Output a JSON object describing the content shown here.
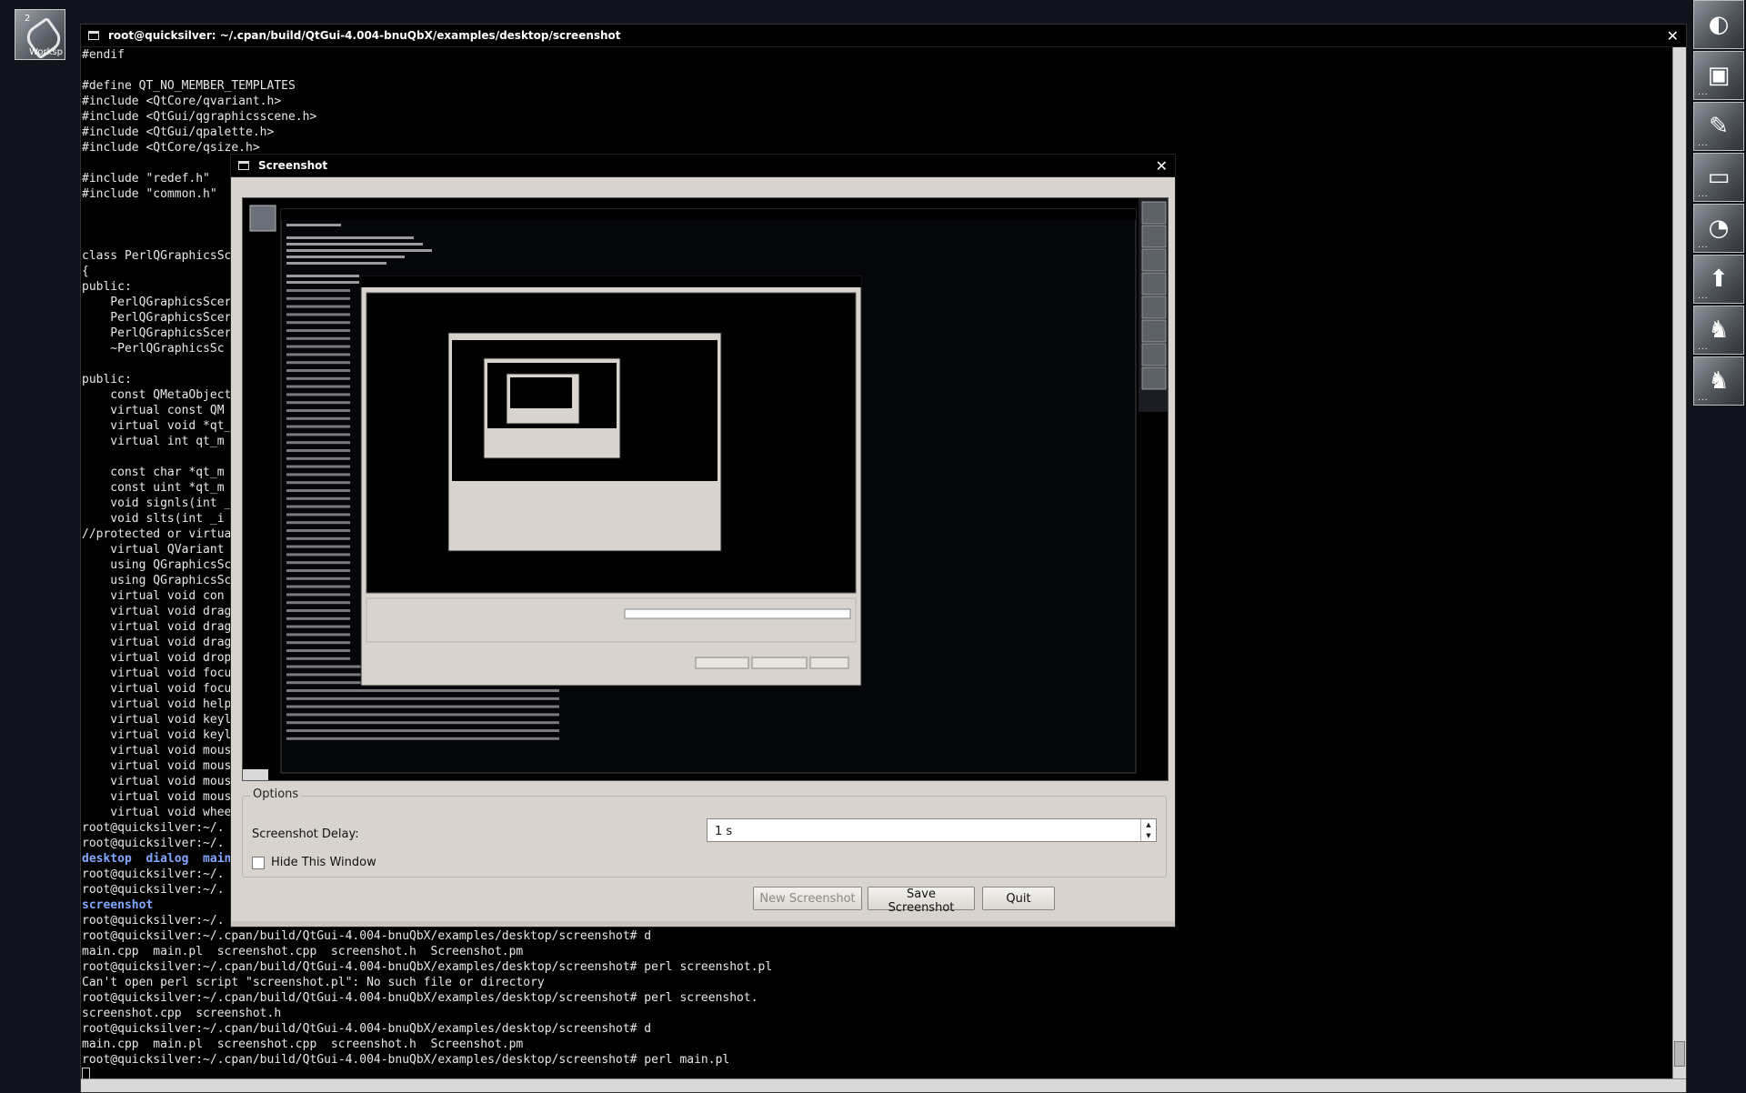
{
  "workspace": {
    "number": "2",
    "label": "Worksp"
  },
  "dock": {
    "tiles": [
      "◐",
      "▣",
      "✎",
      "▭",
      "◔",
      "⬆",
      "♞",
      "♞"
    ]
  },
  "terminal": {
    "title": "root@quicksilver: ~/.cpan/build/QtGui-4.004-bnuQbX/examples/desktop/screenshot",
    "close": "✕",
    "lines": [
      "#endif",
      "",
      "#define QT_NO_MEMBER_TEMPLATES",
      "#include <QtCore/qvariant.h>",
      "#include <QtGui/qgraphicsscene.h>",
      "#include <QtGui/qpalette.h>",
      "#include <QtCore/qsize.h>",
      "",
      "#include \"redef.h\"",
      "#include \"common.h\"",
      "",
      "",
      "",
      "class PerlQGraphicsSc",
      "{",
      "public:",
      "    PerlQGraphicsScer",
      "    PerlQGraphicsScer",
      "    PerlQGraphicsScer",
      "    ~PerlQGraphicsSc",
      "",
      "public:",
      "    const QMetaObject",
      "    virtual const QM",
      "    virtual void *qt_",
      "    virtual int qt_m",
      "",
      "    const char *qt_m",
      "    const uint *qt_m",
      "    void signls(int _",
      "    void slts(int _i",
      "//protected or virtua",
      "    virtual QVariant",
      "    using QGraphicsSc",
      "    using QGraphicsSc",
      "    virtual void con",
      "    virtual void drag",
      "    virtual void drag",
      "    virtual void drag",
      "    virtual void drop",
      "    virtual void focu",
      "    virtual void focu",
      "    virtual void help",
      "    virtual void keyl",
      "    virtual void keyl",
      "    virtual void mous",
      "    virtual void mous",
      "    virtual void mous",
      "    virtual void mous",
      "    virtual void whee",
      "root@quicksilver:~/.",
      "root@quicksilver:~/."
    ],
    "ls_line": "desktop  dialog  main",
    "lines_b": [
      "root@quicksilver:~/.",
      "root@quicksilver:~/."
    ],
    "screenshot_dir": "screenshot",
    "lines_c": [
      "root@quicksilver:~/.",
      "root@quicksilver:~/.cpan/build/QtGui-4.004-bnuQbX/examples/desktop/screenshot# d",
      "main.cpp  main.pl  screenshot.cpp  screenshot.h  Screenshot.pm",
      "root@quicksilver:~/.cpan/build/QtGui-4.004-bnuQbX/examples/desktop/screenshot# perl screenshot.pl",
      "Can't open perl script \"screenshot.pl\": No such file or directory",
      "root@quicksilver:~/.cpan/build/QtGui-4.004-bnuQbX/examples/desktop/screenshot# perl screenshot.",
      "screenshot.cpp  screenshot.h",
      "root@quicksilver:~/.cpan/build/QtGui-4.004-bnuQbX/examples/desktop/screenshot# d",
      "main.cpp  main.pl  screenshot.cpp  screenshot.h  Screenshot.pm",
      "root@quicksilver:~/.cpan/build/QtGui-4.004-bnuQbX/examples/desktop/screenshot# perl main.pl"
    ]
  },
  "dialog": {
    "title": "Screenshot",
    "close": "✕",
    "options_title": "Options",
    "delay_label": "Screenshot Delay:",
    "delay_value": "1 s",
    "hide_label": "Hide This Window",
    "hide_checked": false,
    "new_screenshot": "New Screenshot",
    "new_screenshot_enabled": false,
    "save_screenshot": "Save Screenshot",
    "quit": "Quit"
  }
}
